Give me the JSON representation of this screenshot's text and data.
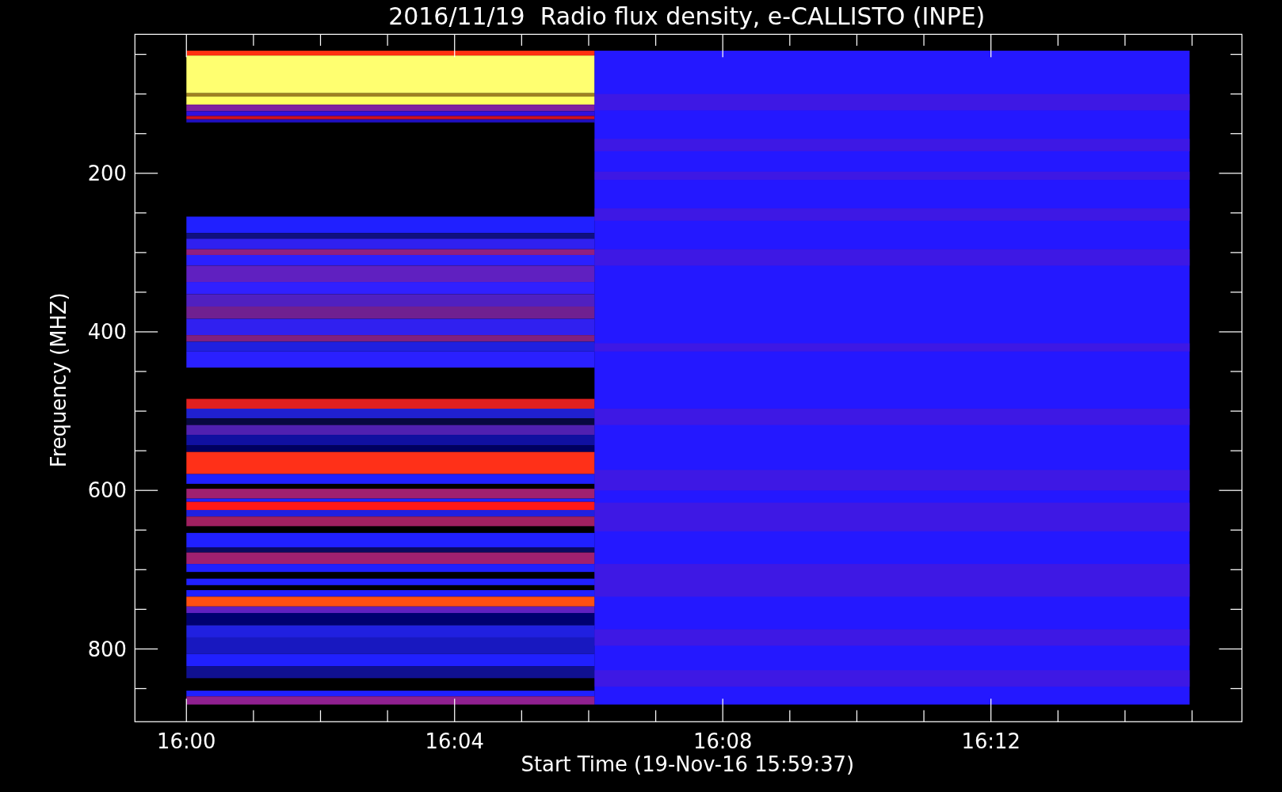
{
  "title": "2016/11/19  Radio flux density, e-CALLISTO (INPE)",
  "y_axis": {
    "label": "Frequency (MHZ)",
    "ticks": [
      "200",
      "400",
      "600",
      "800"
    ]
  },
  "x_axis": {
    "label": "Start Time (19-Nov-16 15:59:37)",
    "ticks": [
      "16:00",
      "16:04",
      "16:08",
      "16:12"
    ]
  }
}
